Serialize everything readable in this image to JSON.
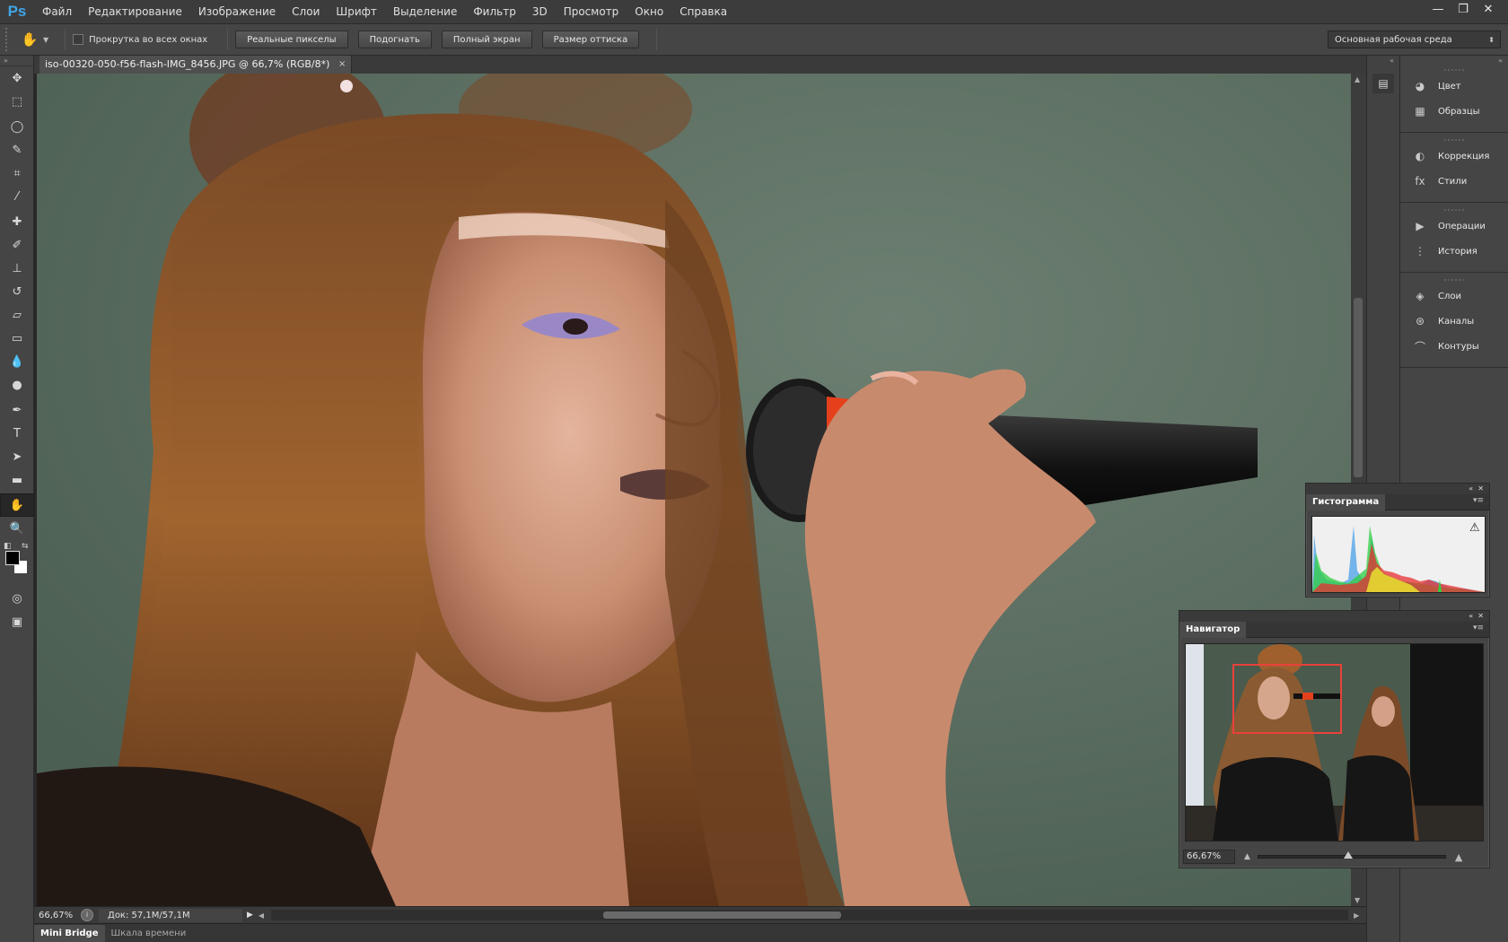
{
  "app": {
    "logo": "Ps"
  },
  "menu": [
    "Файл",
    "Редактирование",
    "Изображение",
    "Слои",
    "Шрифт",
    "Выделение",
    "Фильтр",
    "3D",
    "Просмотр",
    "Окно",
    "Справка"
  ],
  "window_controls": {
    "minimize": "—",
    "restore": "❐",
    "close": "✕"
  },
  "options": {
    "scroll_all_label": "Прокрутка во всех окнах",
    "buttons": [
      "Реальные пикселы",
      "Подогнать",
      "Полный экран",
      "Размер оттиска"
    ],
    "workspace": "Основная рабочая среда"
  },
  "tools": [
    {
      "name": "move-tool-icon",
      "glyph": "✥"
    },
    {
      "name": "marquee-tool-icon",
      "glyph": "⬚"
    },
    {
      "name": "lasso-tool-icon",
      "glyph": "◯"
    },
    {
      "name": "quick-select-tool-icon",
      "glyph": "✎"
    },
    {
      "name": "crop-tool-icon",
      "glyph": "⌗"
    },
    {
      "name": "eyedropper-tool-icon",
      "glyph": "⁄"
    },
    {
      "name": "healing-tool-icon",
      "glyph": "✚"
    },
    {
      "name": "brush-tool-icon",
      "glyph": "✐"
    },
    {
      "name": "stamp-tool-icon",
      "glyph": "⊥"
    },
    {
      "name": "history-brush-tool-icon",
      "glyph": "↺"
    },
    {
      "name": "eraser-tool-icon",
      "glyph": "▱"
    },
    {
      "name": "gradient-tool-icon",
      "glyph": "▭"
    },
    {
      "name": "blur-tool-icon",
      "glyph": "💧"
    },
    {
      "name": "dodge-tool-icon",
      "glyph": "●"
    },
    {
      "name": "pen-tool-icon",
      "glyph": "✒"
    },
    {
      "name": "type-tool-icon",
      "glyph": "T"
    },
    {
      "name": "path-select-tool-icon",
      "glyph": "➤"
    },
    {
      "name": "shape-tool-icon",
      "glyph": "▬"
    },
    {
      "name": "hand-tool-icon",
      "glyph": "✋"
    },
    {
      "name": "zoom-tool-icon",
      "glyph": "🔍"
    }
  ],
  "document": {
    "tab_title": "iso-00320-050-f56-flash-IMG_8456.JPG @ 66,7% (RGB/8*)",
    "close": "×"
  },
  "status": {
    "zoom": "66,67%",
    "doc": "Док: 57,1M/57,1M"
  },
  "bottom_tabs": [
    "Mini Bridge",
    "Шкала времени"
  ],
  "dock": {
    "groups": [
      [
        {
          "label": "Цвет",
          "icon": "color-icon",
          "glyph": "◕"
        },
        {
          "label": "Образцы",
          "icon": "swatches-icon",
          "glyph": "▦"
        }
      ],
      [
        {
          "label": "Коррекция",
          "icon": "adjustments-icon",
          "glyph": "◐"
        },
        {
          "label": "Стили",
          "icon": "styles-icon",
          "glyph": "fx"
        }
      ],
      [
        {
          "label": "Операции",
          "icon": "actions-icon",
          "glyph": "▶"
        },
        {
          "label": "История",
          "icon": "history-icon",
          "glyph": "⋮"
        }
      ],
      [
        {
          "label": "Слои",
          "icon": "layers-icon",
          "glyph": "◈"
        },
        {
          "label": "Каналы",
          "icon": "channels-icon",
          "glyph": "⊛"
        },
        {
          "label": "Контуры",
          "icon": "paths-icon",
          "glyph": "⌒"
        }
      ]
    ]
  },
  "histogram": {
    "title": "Гистограмма"
  },
  "navigator": {
    "title": "Навигатор",
    "zoom": "66,67%"
  }
}
